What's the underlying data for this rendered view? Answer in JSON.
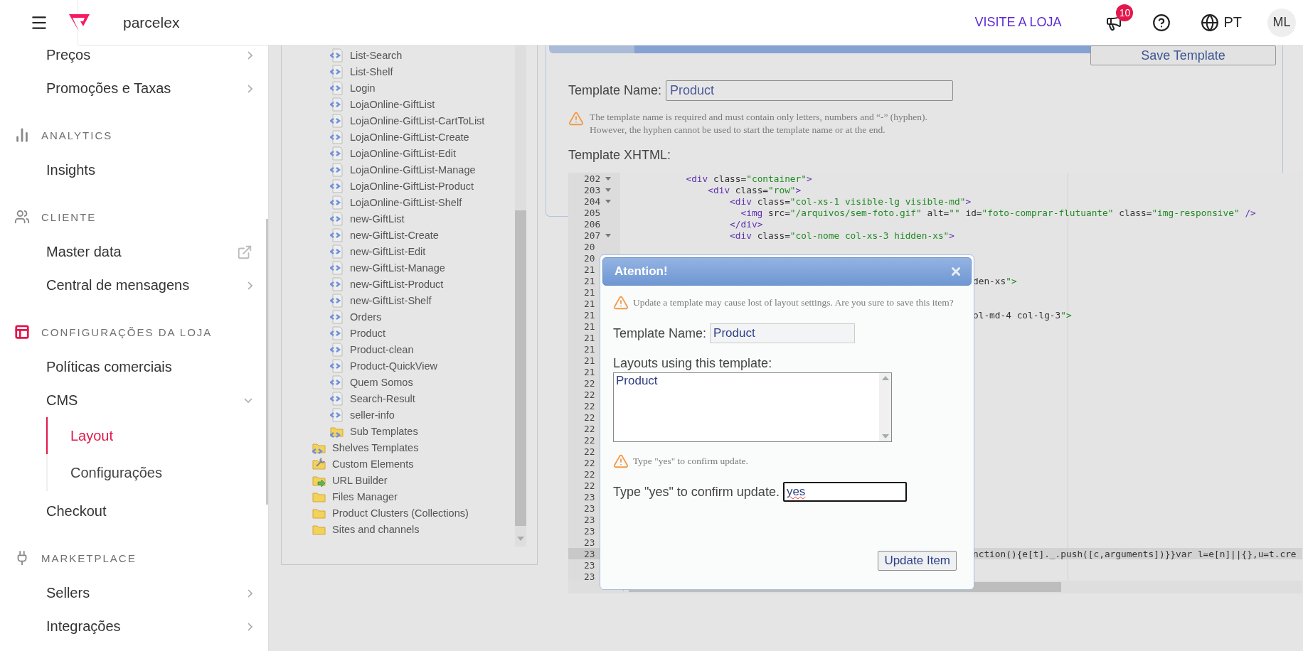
{
  "topbar": {
    "brand": "parcelex",
    "store_link": "VISITE A LOJA",
    "notifications": "10",
    "language": "PT",
    "avatar": "ML"
  },
  "sidebar": {
    "groups": [
      {
        "items": [
          {
            "kind": "menu",
            "label": "Preços",
            "expanded": false,
            "selected": false
          },
          {
            "kind": "menu",
            "label": "Promoções e Taxas",
            "expanded": false,
            "selected": false
          }
        ]
      },
      {
        "title": "ANALYTICS",
        "items": [
          {
            "kind": "link",
            "label": "Insights",
            "selected": false
          }
        ]
      },
      {
        "title": "CLIENTE",
        "items": [
          {
            "kind": "external",
            "label": "Master data",
            "selected": false
          },
          {
            "kind": "menu",
            "label": "Central de mensagens",
            "expanded": false,
            "selected": false
          }
        ]
      },
      {
        "title": "CONFIGURAÇÕES DA LOJA",
        "items": [
          {
            "kind": "link",
            "label": "Políticas comerciais",
            "selected": false
          },
          {
            "kind": "menu",
            "label": "CMS",
            "expanded": true,
            "selected": false,
            "children": [
              {
                "label": "Layout",
                "selected": true
              },
              {
                "label": "Configurações",
                "selected": false
              }
            ]
          },
          {
            "kind": "link",
            "label": "Checkout",
            "selected": false
          }
        ]
      },
      {
        "title": "MARKETPLACE",
        "items": [
          {
            "kind": "menu",
            "label": "Sellers",
            "expanded": false,
            "selected": false
          },
          {
            "kind": "menu",
            "label": "Integrações",
            "expanded": false,
            "selected": false
          }
        ]
      }
    ]
  },
  "tree": {
    "items": [
      {
        "children": [
          {
            "kind": "template",
            "label": "List-Search"
          },
          {
            "kind": "template",
            "label": "List-Shelf"
          },
          {
            "kind": "template",
            "label": "Login"
          },
          {
            "kind": "template",
            "label": "LojaOnline-GiftList"
          },
          {
            "kind": "template",
            "label": "LojaOnline-GiftList-CartToList"
          },
          {
            "kind": "template",
            "label": "LojaOnline-GiftList-Create"
          },
          {
            "kind": "template",
            "label": "LojaOnline-GiftList-Edit"
          },
          {
            "kind": "template",
            "label": "LojaOnline-GiftList-Manage"
          },
          {
            "kind": "template",
            "label": "LojaOnline-GiftList-Product"
          },
          {
            "kind": "template",
            "label": "LojaOnline-GiftList-Shelf"
          },
          {
            "kind": "template",
            "label": "new-GiftList"
          },
          {
            "kind": "template",
            "label": "new-GiftList-Create"
          },
          {
            "kind": "template",
            "label": "new-GiftList-Edit"
          },
          {
            "kind": "template",
            "label": "new-GiftList-Manage"
          },
          {
            "kind": "template",
            "label": "new-GiftList-Product"
          },
          {
            "kind": "template",
            "label": "new-GiftList-Shelf"
          },
          {
            "kind": "template",
            "label": "Orders"
          },
          {
            "kind": "template",
            "label": "Product"
          },
          {
            "kind": "template",
            "label": "Product-clean"
          },
          {
            "kind": "template",
            "label": "Product-QuickView"
          },
          {
            "kind": "template",
            "label": "Quem Somos"
          },
          {
            "kind": "template",
            "label": "Search-Result"
          },
          {
            "kind": "template",
            "label": "seller-info"
          },
          {
            "kind": "template-folder",
            "label": "Sub Templates"
          }
        ]
      },
      {
        "kind": "template-folder",
        "label": "Shelves Templates"
      },
      {
        "kind": "tools-folder",
        "label": "Custom Elements"
      },
      {
        "kind": "link-folder",
        "label": "URL Builder"
      },
      {
        "kind": "folder",
        "label": "Files Manager"
      },
      {
        "kind": "folder",
        "label": "Product Clusters (Collections)"
      },
      {
        "kind": "folder",
        "label": "Sites and channels"
      }
    ]
  },
  "template_form": {
    "save_button": "Save Template",
    "name_label": "Template Name:",
    "name_value": "Product",
    "hint": [
      "The template name is required and must contain only letters, numbers and “-” (hyphen).",
      "However, the hyphen cannot be used to start the template name or at the end."
    ],
    "xhtml_label": "Template XHTML:"
  },
  "editor": {
    "lines": [
      {
        "kind": "full",
        "number": "202",
        "fold": true,
        "active": false,
        "code": "            <div class=\"container\">"
      },
      {
        "kind": "full",
        "number": "203",
        "fold": true,
        "active": false,
        "code": "                <div class=\"row\">"
      },
      {
        "kind": "full",
        "number": "204",
        "fold": true,
        "active": false,
        "code": "                    <div class=\"col-xs-1 visible-lg visible-md\">"
      },
      {
        "kind": "full",
        "number": "205",
        "fold": false,
        "active": false,
        "code": "                      <img src=\"/arquivos/sem-foto.gif\" alt=\"\" id=\"foto-comprar-flutuante\" class=\"img-responsive\" />"
      },
      {
        "kind": "full",
        "number": "206",
        "fold": false,
        "active": false,
        "code": "                    </div>"
      },
      {
        "kind": "full",
        "number": "207",
        "fold": true,
        "active": false,
        "code": "                    <div class=\"col-nome col-xs-3 hidden-xs\">"
      },
      {
        "kind": "covered",
        "number": "20",
        "fold": false,
        "active": false
      },
      {
        "kind": "covered",
        "number": "20",
        "fold": false,
        "active": false
      },
      {
        "kind": "covered",
        "number": "21",
        "fold": false,
        "active": false
      },
      {
        "kind": "tail",
        "number": "21",
        "fold": false,
        "active": false,
        "code": "den-xs\">"
      },
      {
        "kind": "covered",
        "number": "21",
        "fold": false,
        "active": false
      },
      {
        "kind": "covered",
        "number": "21",
        "fold": false,
        "active": false
      },
      {
        "kind": "tail",
        "number": "21",
        "fold": false,
        "active": false,
        "code": "ol-md-4 col-lg-3\">"
      },
      {
        "kind": "covered",
        "number": "21",
        "fold": false,
        "active": false
      },
      {
        "kind": "covered",
        "number": "21",
        "fold": false,
        "active": false
      },
      {
        "kind": "covered",
        "number": "21",
        "fold": false,
        "active": false
      },
      {
        "kind": "covered",
        "number": "21",
        "fold": false,
        "active": false
      },
      {
        "kind": "covered",
        "number": "21",
        "fold": false,
        "active": false
      },
      {
        "kind": "covered",
        "number": "22",
        "fold": false,
        "active": false
      },
      {
        "kind": "covered",
        "number": "22",
        "fold": false,
        "active": false
      },
      {
        "kind": "covered",
        "number": "22",
        "fold": false,
        "active": false
      },
      {
        "kind": "covered",
        "number": "22",
        "fold": false,
        "active": false
      },
      {
        "kind": "covered",
        "number": "22",
        "fold": false,
        "active": false
      },
      {
        "kind": "covered",
        "number": "22",
        "fold": false,
        "active": false
      },
      {
        "kind": "covered",
        "number": "22",
        "fold": false,
        "active": false
      },
      {
        "kind": "covered",
        "number": "22",
        "fold": false,
        "active": false
      },
      {
        "kind": "covered",
        "number": "22",
        "fold": false,
        "active": false
      },
      {
        "kind": "covered",
        "number": "22",
        "fold": false,
        "active": false
      },
      {
        "kind": "covered",
        "number": "23",
        "fold": false,
        "active": false
      },
      {
        "kind": "covered",
        "number": "23",
        "fold": false,
        "active": false
      },
      {
        "kind": "covered",
        "number": "23",
        "fold": false,
        "active": false
      },
      {
        "kind": "covered",
        "number": "23",
        "fold": false,
        "active": false
      },
      {
        "kind": "covered",
        "number": "23",
        "fold": false,
        "active": false
      },
      {
        "kind": "tail",
        "number": "23",
        "fold": false,
        "active": true,
        "code": "nction(){e[t]._.push([c,arguments])}}var l=e[n]||{},u=t.cre"
      },
      {
        "kind": "covered",
        "number": "23",
        "fold": false,
        "active": false
      },
      {
        "kind": "covered",
        "number": "23",
        "fold": false,
        "active": false
      }
    ]
  },
  "modal": {
    "title": "Atention!",
    "warning": "Update a template may cause lost of layout settings. Are you sure to save this item?",
    "name_label": "Template Name:",
    "name_value": "Product",
    "layouts_label": "Layouts using this template:",
    "layouts": [
      "Product"
    ],
    "confirm_hint": "Type \"yes\" to confirm update.",
    "confirm_label": "Type \"yes\" to confirm update.",
    "confirm_value": "yes",
    "submit": "Update Item"
  }
}
